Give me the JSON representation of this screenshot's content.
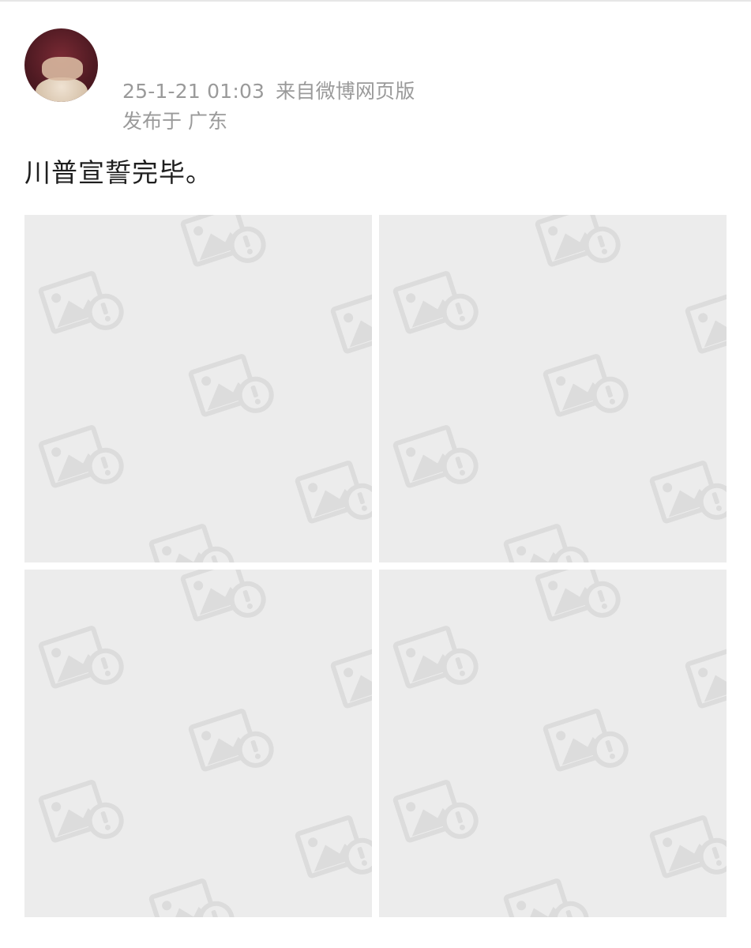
{
  "post": {
    "timestamp": "25-1-21 01:03",
    "source": "来自微博网页版",
    "location_prefix": "发布于",
    "location": "广东",
    "text": "川普宣誓完毕。"
  },
  "images": [
    {
      "alt": "broken-image-placeholder"
    },
    {
      "alt": "broken-image-placeholder"
    },
    {
      "alt": "broken-image-placeholder"
    },
    {
      "alt": "broken-image-placeholder"
    }
  ],
  "colors": {
    "placeholder_bg": "#ececec",
    "watermark": "#dcdcdc",
    "meta_text": "#9a9a9a",
    "body_text": "#1f1f1f"
  },
  "icons": {
    "placeholder_icon": "image-error-icon"
  }
}
